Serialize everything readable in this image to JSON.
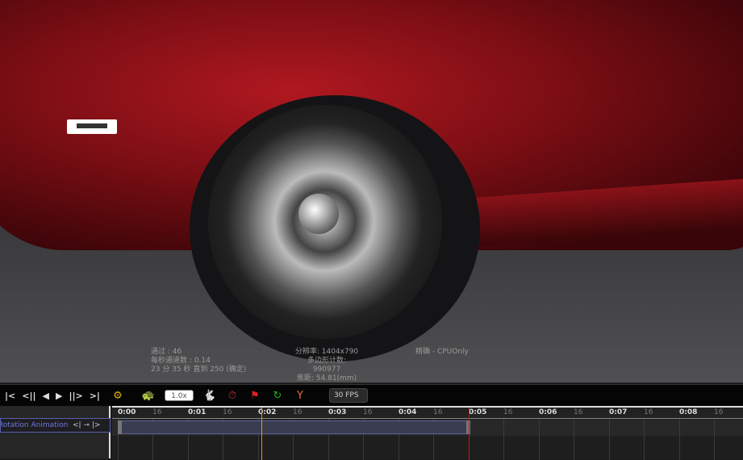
{
  "render_info": {
    "passes": "通过 : 46",
    "passes_per_sec": "每秒通道数 : 0.14",
    "time_remaining": "23 分 35 秒 直到 250 (确定)",
    "resolution": "分辨率: 1404x790",
    "polygon_count": "多边形计数: 990977",
    "focal_length": "焦距: 54.81(mm)",
    "mode": "精确 - CPUOnly"
  },
  "toolbar": {
    "transport": [
      "|<",
      "<||",
      "◀",
      "▶",
      "||>",
      ">|"
    ],
    "speed_value": "1.0x",
    "fps": "30 FPS"
  },
  "timeline": {
    "track_name": "Rotation Animation",
    "labels": [
      "0:00",
      "0:01",
      "0:02",
      "0:03",
      "0:04",
      "0:05",
      "0:06",
      "0:07",
      "0:08"
    ],
    "sub_label": "16",
    "playhead_seconds": 2.05,
    "end_seconds": 5.0,
    "clip_start_seconds": 0,
    "clip_end_seconds": 5.0
  },
  "colors": {
    "playhead": "#e0a000",
    "end_marker": "#d01020",
    "track_accent": "#5a60b0"
  }
}
